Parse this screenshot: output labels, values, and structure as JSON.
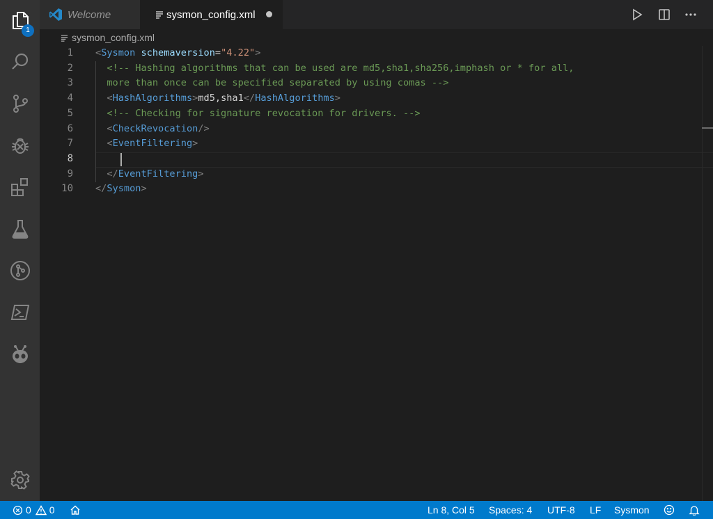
{
  "activity_bar": {
    "explorer_badge": "1",
    "items": [
      "files-icon",
      "search-icon",
      "source-control-icon",
      "debug-icon",
      "extensions-icon",
      "testing-icon",
      "git-graph-icon",
      "powershell-icon",
      "platformio-icon"
    ],
    "settings_icon": "gear-icon"
  },
  "tabs": [
    {
      "label": "Welcome",
      "icon": "vscode-logo-icon"
    },
    {
      "label": "sysmon_config.xml",
      "icon": "file-lines-icon",
      "modified": true
    }
  ],
  "toolbar": {
    "run_icon": "play-icon",
    "split_icon": "split-editor-icon",
    "more_icon": "ellipsis-icon"
  },
  "breadcrumb": {
    "file": "sysmon_config.xml"
  },
  "editor": {
    "line_numbers": [
      "1",
      "2",
      "3",
      "4",
      "5",
      "6",
      "7",
      "8",
      "9",
      "10"
    ],
    "current_line": "8",
    "lines": [
      [
        {
          "c": "bracket",
          "t": "<"
        },
        {
          "c": "tag",
          "t": "Sysmon"
        },
        {
          "c": "text",
          "t": " "
        },
        {
          "c": "attr",
          "t": "schemaversion"
        },
        {
          "c": "text",
          "t": "="
        },
        {
          "c": "str",
          "t": "\"4.22\""
        },
        {
          "c": "bracket",
          "t": ">"
        }
      ],
      [
        {
          "c": "text",
          "t": "  "
        },
        {
          "c": "cmt",
          "t": "<!-- Hashing algorithms that can be used are md5,sha1,sha256,imphash or * for all,"
        }
      ],
      [
        {
          "c": "text",
          "t": "  "
        },
        {
          "c": "cmt",
          "t": "more than once can be specified separated by using comas -->"
        }
      ],
      [
        {
          "c": "text",
          "t": "  "
        },
        {
          "c": "bracket",
          "t": "<"
        },
        {
          "c": "tag",
          "t": "HashAlgorithms"
        },
        {
          "c": "bracket",
          "t": ">"
        },
        {
          "c": "text",
          "t": "md5,sha1"
        },
        {
          "c": "bracket",
          "t": "</"
        },
        {
          "c": "tag",
          "t": "HashAlgorithms"
        },
        {
          "c": "bracket",
          "t": ">"
        }
      ],
      [
        {
          "c": "text",
          "t": "  "
        },
        {
          "c": "cmt",
          "t": "<!-- Checking for signature revocation for drivers. -->"
        }
      ],
      [
        {
          "c": "text",
          "t": "  "
        },
        {
          "c": "bracket",
          "t": "<"
        },
        {
          "c": "tag",
          "t": "CheckRevocation"
        },
        {
          "c": "bracket",
          "t": "/>"
        }
      ],
      [
        {
          "c": "text",
          "t": "  "
        },
        {
          "c": "bracket",
          "t": "<"
        },
        {
          "c": "tag",
          "t": "EventFiltering"
        },
        {
          "c": "bracket",
          "t": ">"
        }
      ],
      [
        {
          "c": "text",
          "t": ""
        }
      ],
      [
        {
          "c": "text",
          "t": "  "
        },
        {
          "c": "bracket",
          "t": "</"
        },
        {
          "c": "tag",
          "t": "EventFiltering"
        },
        {
          "c": "bracket",
          "t": ">"
        }
      ],
      [
        {
          "c": "bracket",
          "t": "</"
        },
        {
          "c": "tag",
          "t": "Sysmon"
        },
        {
          "c": "bracket",
          "t": ">"
        }
      ]
    ]
  },
  "statusbar": {
    "errors": "0",
    "warnings": "0",
    "home_icon": "home-icon",
    "position": "Ln 8, Col 5",
    "spaces": "Spaces: 4",
    "encoding": "UTF-8",
    "eol": "LF",
    "language": "Sysmon",
    "feedback_icon": "smiley-icon",
    "notifications_icon": "bell-icon"
  },
  "colors": {
    "status_bar": "#007acc",
    "tag": "#569cd6",
    "attribute": "#9cdcfe",
    "string": "#ce9178",
    "comment": "#6a9955",
    "bracket": "#808080",
    "text": "#d4d4d4"
  }
}
